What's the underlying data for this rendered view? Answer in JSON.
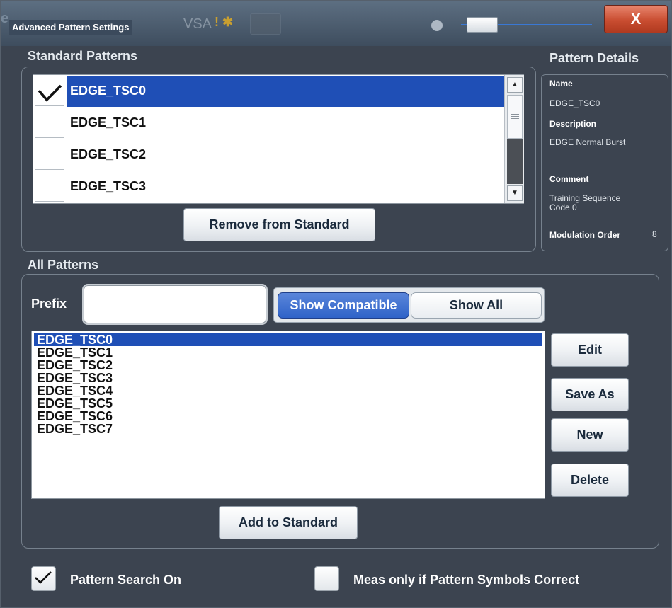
{
  "window": {
    "title": "Advanced Pattern Settings",
    "title_ghost_left": "e",
    "title_ghost_right": "VSA",
    "close_label": "X"
  },
  "standard_patterns": {
    "heading": "Standard Patterns",
    "items": [
      {
        "label": "EDGE_TSC0",
        "checked": true,
        "selected": true
      },
      {
        "label": "EDGE_TSC1",
        "checked": false,
        "selected": false
      },
      {
        "label": "EDGE_TSC2",
        "checked": false,
        "selected": false
      },
      {
        "label": "EDGE_TSC3",
        "checked": false,
        "selected": false
      }
    ],
    "remove_button": "Remove from Standard"
  },
  "pattern_details": {
    "heading": "Pattern Details",
    "name_label": "Name",
    "name_value": "EDGE_TSC0",
    "description_label": "Description",
    "description_value": "EDGE Normal Burst",
    "comment_label": "Comment",
    "comment_value": "Training Sequence Code 0",
    "modulation_label": "Modulation Order",
    "modulation_value": "8"
  },
  "all_patterns": {
    "heading": "All Patterns",
    "prefix_label": "Prefix",
    "prefix_value": "",
    "show_compatible": "Show Compatible",
    "show_all": "Show All",
    "active_filter": "Show Compatible",
    "items": [
      "EDGE_TSC0",
      "EDGE_TSC1",
      "EDGE_TSC2",
      "EDGE_TSC3",
      "EDGE_TSC4",
      "EDGE_TSC5",
      "EDGE_TSC6",
      "EDGE_TSC7"
    ],
    "selected_index": 0,
    "edit_button": "Edit",
    "save_as_button": "Save As",
    "new_button": "New",
    "delete_button": "Delete",
    "add_button": "Add to Standard"
  },
  "options": {
    "pattern_search_label": "Pattern Search On",
    "pattern_search_checked": true,
    "meas_only_label": "Meas only if Pattern Symbols Correct",
    "meas_only_checked": false
  },
  "colors": {
    "selection": "#1f4fb6",
    "close_button": "#c94d31",
    "dialog_background": "#3c4450"
  }
}
